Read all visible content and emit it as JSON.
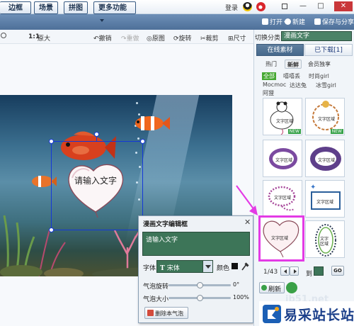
{
  "topbar": {
    "login": "登录",
    "minimize": "—",
    "maximize": "□",
    "close": "✕"
  },
  "tabs": {
    "border": "边框",
    "scene": "场景",
    "collage": "拼图",
    "more": "更多功能"
  },
  "actions": {
    "open": "打开",
    "new": "新建",
    "save_share": "保存与分享"
  },
  "toolbar": {
    "scale_11": "1:1",
    "original_size": "原大",
    "undo": "撤销",
    "redo": "重做",
    "reset": "原图",
    "rotate": "旋转",
    "crop": "裁剪",
    "size": "尺寸"
  },
  "canvas": {
    "bubble_text": "请输入文字"
  },
  "dialog": {
    "title": "漫画文字编辑框",
    "close": "✕",
    "input_value": "请输入文字",
    "font_label": "字体",
    "font_icon": "T",
    "font_value": "宋体",
    "color_label": "颜色",
    "color_value": "#111111",
    "rotate_label": "气泡旋转",
    "rotate_value": "0°",
    "rotate_level": 0.5,
    "size_label": "气泡大小",
    "size_value": "100%",
    "size_level": 0.5,
    "delete_button": "删除本气泡"
  },
  "panel": {
    "category_label": "切换分类",
    "category_value": "漫画文字",
    "tab_online": "在线素材",
    "tab_downloaded": "已下载[1]",
    "filters": [
      "热门",
      "新鲜",
      "会员独享"
    ],
    "tags": [
      "全部",
      "嘻嘻丢",
      "时尚girl",
      "Mocmoc",
      "达达兔",
      "冰雪girl",
      "阿狸"
    ],
    "thumb_label": "文字区域",
    "new_badge": "NEW",
    "pager": "1/43",
    "goto_label": "到",
    "go_button": "GO",
    "refresh_button": "刷新"
  },
  "watermark": {
    "url": "jb51.net",
    "site": "易采站长站"
  },
  "colors": {
    "accent_green": "#3d7558",
    "selection_blue": "#1438d8",
    "highlight_magenta": "#e33be5"
  },
  "icons": {
    "qq": "qq-icon",
    "weibo": "weibo-icon",
    "open": "folder-icon",
    "new": "plus-icon",
    "save": "save-icon",
    "eyedropper": "eyedropper-icon",
    "delete": "delete-icon",
    "refresh": "refresh-icon"
  }
}
